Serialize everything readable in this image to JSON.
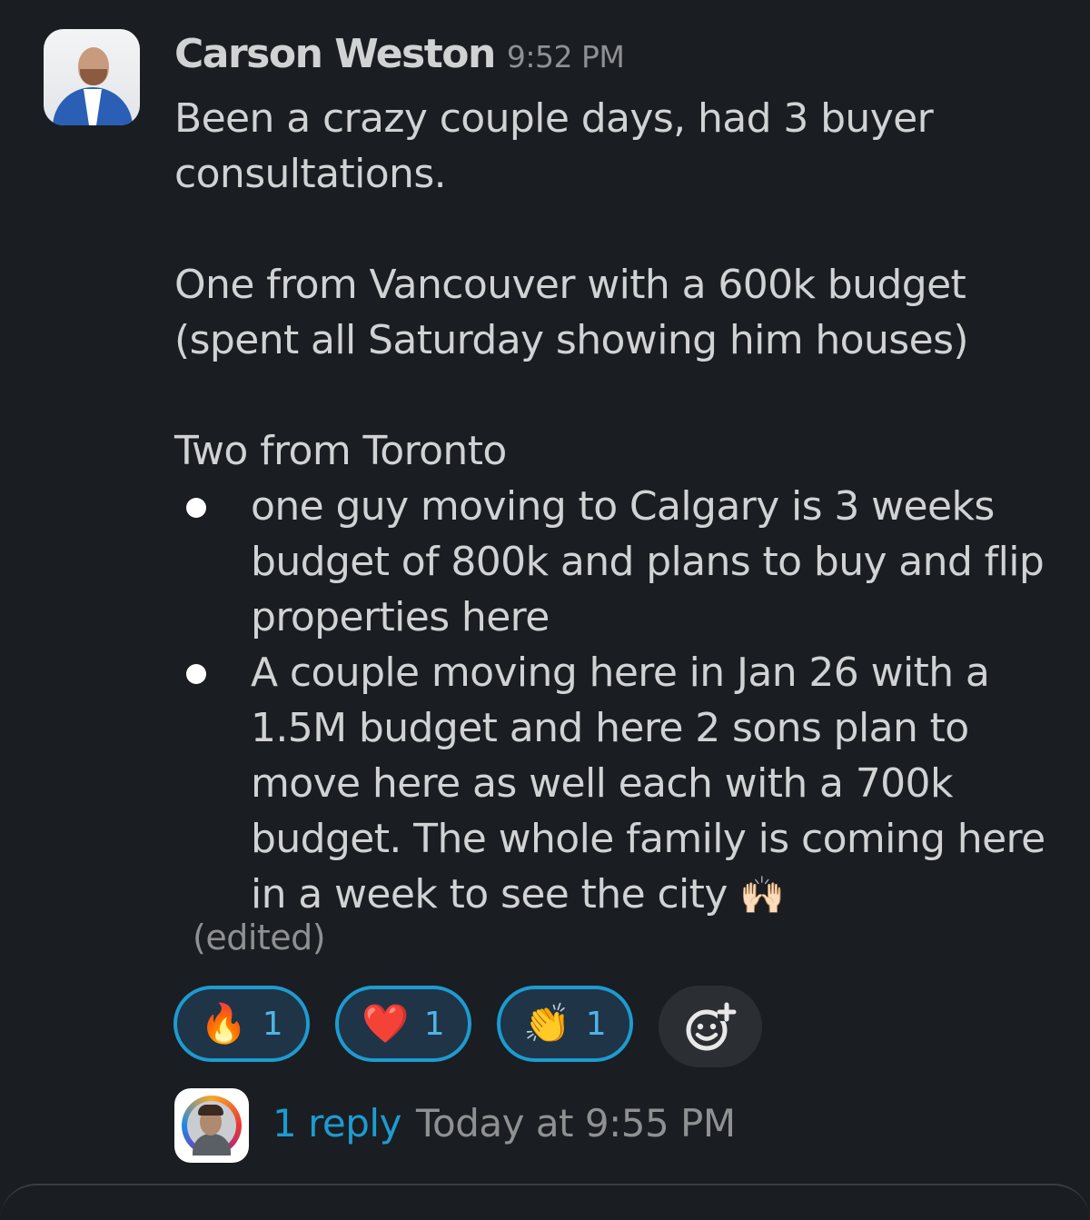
{
  "message": {
    "author": "Carson Weston",
    "time": "9:52 PM",
    "lines": {
      "intro": "Been a crazy couple days, had 3 buyer consultations.",
      "vancouver": "One from Vancouver with a 600k budget (spent all Saturday showing him houses)",
      "toronto": "Two from Toronto"
    },
    "bullets": [
      {
        "text": "one guy moving to Calgary is 3 weeks budget of 800k and plans to buy and flip properties here"
      },
      {
        "text": "A couple moving here in Jan 26 with a 1.5M budget and here 2 sons plan to move here as well each with a 700k budget. The whole family is coming here in a week to see the city",
        "emoji": "🙌🏻"
      }
    ],
    "edited": "(edited)"
  },
  "reactions": [
    {
      "emoji": "🔥",
      "count": "1"
    },
    {
      "emoji": "❤️",
      "count": "1"
    },
    {
      "emoji": "👏",
      "count": "1"
    }
  ],
  "add_reaction_icon": "add-reaction-smiley-icon",
  "thread": {
    "reply_label": "1 reply",
    "last_reply": "Today at 9:55 PM"
  },
  "colors": {
    "background": "#1a1d21",
    "text": "#d1d2d3",
    "muted": "#8f9092",
    "link": "#1d9bd1",
    "reaction_border": "#1d9bd1"
  }
}
